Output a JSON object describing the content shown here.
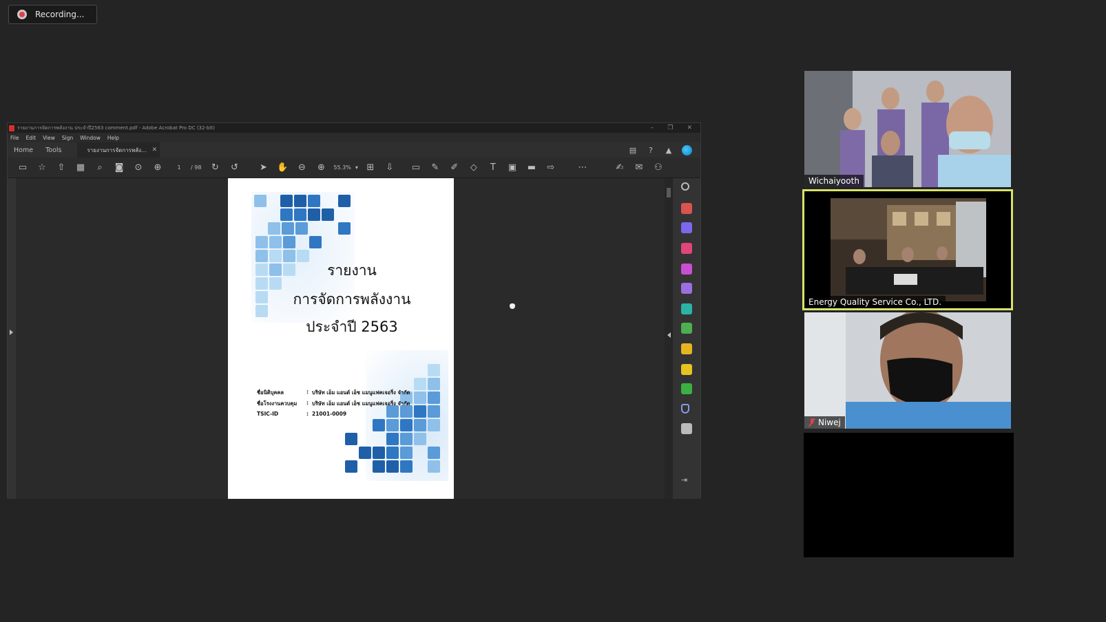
{
  "recording": {
    "label": "Recording..."
  },
  "acrobat": {
    "window_title": "รายงานการจัดการพลังงาน ประจำปี2563 comment.pdf - Adobe Acrobat Pro DC (32-bit)",
    "menu": [
      "File",
      "Edit",
      "View",
      "Sign",
      "Window",
      "Help"
    ],
    "nav_tabs": [
      "Home",
      "Tools"
    ],
    "doc_tab": "รายงานการจัดการพลัง...",
    "page_current": "1",
    "page_total": "/ 98",
    "zoom": "55.3%",
    "colors": {
      "accent": "#3b8fe0"
    }
  },
  "document": {
    "title_line1": "รายงาน",
    "title_line2": "การจัดการพลังงาน",
    "title_line3": "ประจำปี 2563",
    "info": [
      {
        "key": "ชื่อนิติบุคคล",
        "sep": ":",
        "value": "บริษัท เอ็ม แอนด์ เอ็ช แมนูแฟคเจอริ่ง จำกัด"
      },
      {
        "key": "ชื่อโรงงานควบคุม",
        "sep": ":",
        "value": "บริษัท เอ็ม แอนด์ เอ็ช แมนูแฟคเจอริ่ง จำกัด"
      },
      {
        "key": "TSIC-ID",
        "sep": ":",
        "value": "21001-0009"
      }
    ]
  },
  "participants": [
    {
      "name": "Wichaiyooth",
      "muted": false,
      "active": false
    },
    {
      "name": "Energy Quality Service Co., LTD.",
      "muted": false,
      "active": true
    },
    {
      "name": "Niwej",
      "muted": true,
      "active": false
    },
    {
      "name": "",
      "muted": false,
      "active": false
    }
  ]
}
